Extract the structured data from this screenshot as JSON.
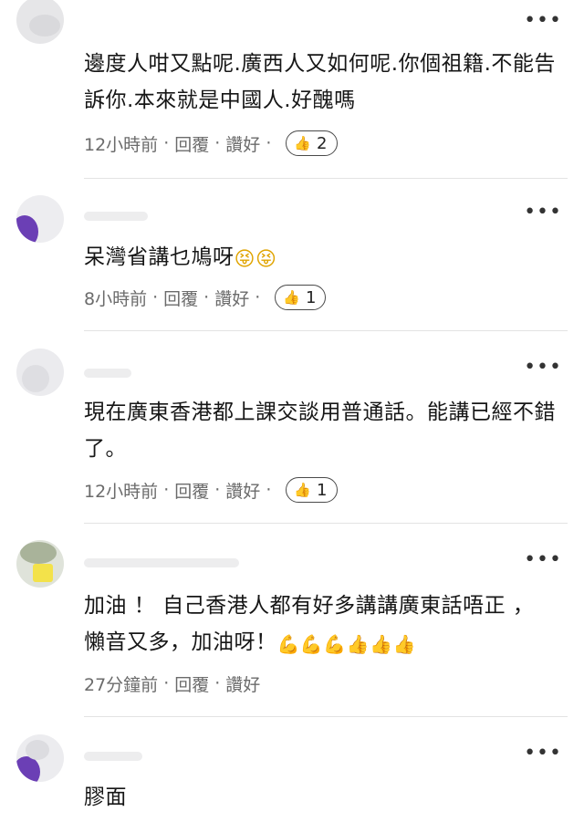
{
  "comments": [
    {
      "text": "邊度人咁又點呢.廣西人又如何呢.你個祖籍.不能告訴你.本來就是中國人.好醜嗎",
      "time": "12小時前",
      "reply": "回覆",
      "like": "讚好",
      "like_count": "2",
      "more": "•••"
    },
    {
      "text": "呆灣省講乜鳩呀",
      "emojis": [
        "😝",
        "😝"
      ],
      "time": "8小時前",
      "reply": "回覆",
      "like": "讚好",
      "like_count": "1",
      "more": "•••"
    },
    {
      "text": "現在廣東香港都上課交談用普通話。能講已經不錯了。",
      "time": "12小時前",
      "reply": "回覆",
      "like": "讚好",
      "like_count": "1",
      "more": "•••"
    },
    {
      "text_line1": "加油 ！ 自己香港人都有好多講講廣東話唔正 ，",
      "text_line2": "懶音又多，加油呀！",
      "emojis": [
        "💪",
        "💪",
        "💪",
        "👍",
        "👍",
        "👍"
      ],
      "time": "27分鐘前",
      "reply": "回覆",
      "like": "讚好",
      "more": "•••"
    },
    {
      "text": "膠面",
      "more": "•••"
    }
  ],
  "icons": {
    "thumb": "thumbs-up-icon",
    "more": "more-dots-icon"
  },
  "colors": {
    "meta_text": "#6b6b6b",
    "divider": "#e3e3e3",
    "avatar_purple": "#6b3fb5"
  }
}
